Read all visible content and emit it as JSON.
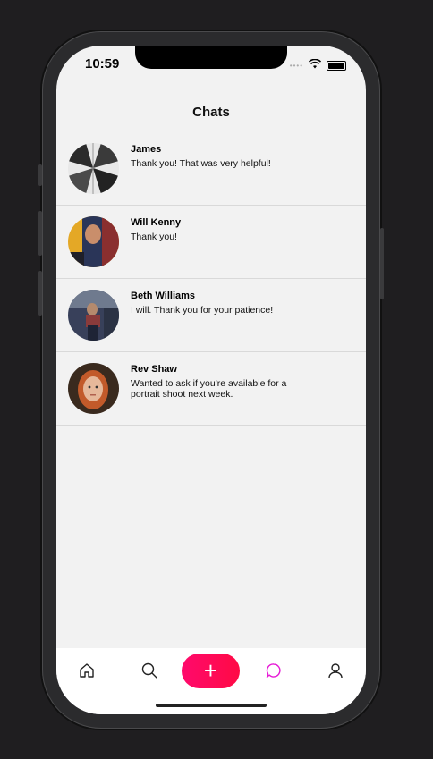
{
  "status_bar": {
    "time": "10:59",
    "signal": "••••"
  },
  "header": {
    "title": "Chats"
  },
  "chats": [
    {
      "name": "James",
      "message": "Thank you! That was very helpful!"
    },
    {
      "name": "Will Kenny",
      "message": "Thank you!"
    },
    {
      "name": "Beth Williams",
      "message": "I will. Thank you for your patience!"
    },
    {
      "name": "Rev Shaw",
      "message": "Wanted to ask if you're available for a portrait shoot next week."
    }
  ],
  "tabbar": {
    "items": [
      "home-icon",
      "search-icon",
      "plus-icon",
      "chat-bubble-icon",
      "user-icon"
    ],
    "add_label": "+",
    "accent_color": "#ff0a6c",
    "active_color": "#e61ad6"
  }
}
